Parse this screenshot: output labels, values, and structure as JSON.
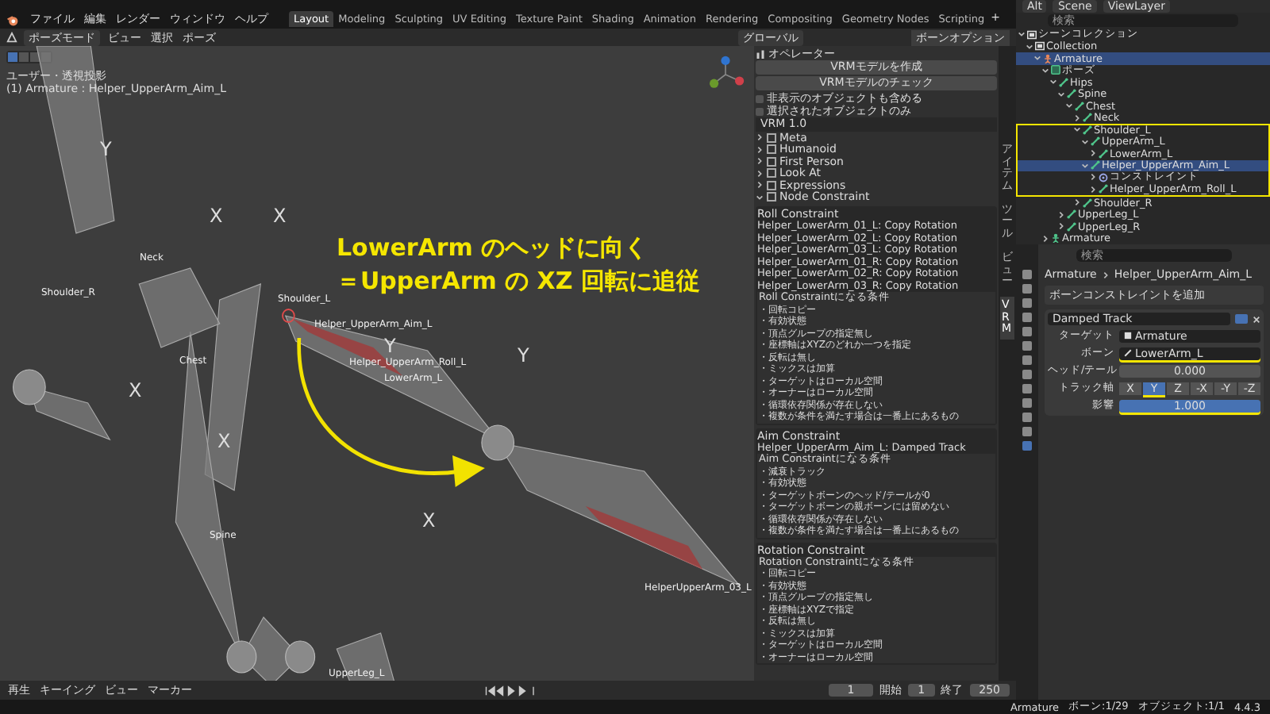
{
  "top_bar": {
    "menus": [
      "ファイル",
      "編集",
      "レンダー",
      "ウィンドウ",
      "ヘルプ"
    ],
    "workspaces": [
      {
        "label": "Layout",
        "selected": true
      },
      {
        "label": "Modeling",
        "selected": false
      },
      {
        "label": "Sculpting",
        "selected": false
      },
      {
        "label": "UV Editing",
        "selected": false
      },
      {
        "label": "Texture Paint",
        "selected": false
      },
      {
        "label": "Shading",
        "selected": false
      },
      {
        "label": "Animation",
        "selected": false
      },
      {
        "label": "Rendering",
        "selected": false
      },
      {
        "label": "Compositing",
        "selected": false
      },
      {
        "label": "Geometry Nodes",
        "selected": false
      },
      {
        "label": "Scripting",
        "selected": false
      }
    ],
    "add_tab": "+"
  },
  "viewport": {
    "mode": "ポーズモード",
    "menus": [
      "ビュー",
      "選択",
      "ポーズ"
    ],
    "orientation": "グローバル",
    "panel_tab": "ボーンオプション",
    "view_label": "ユーザー・透視投影",
    "object_label": "(1) Armature : Helper_UpperArm_Aim_L",
    "bone_labels": [
      "Neck",
      "Shoulder_L",
      "Shoulder_R",
      "Chest",
      "Spine",
      "Helper_UpperArm_Aim_L",
      "Helper_UpperArm_Roll_L",
      "LowerArm_L",
      "HelperUpperArm_03_L",
      "UpperLeg_L"
    ],
    "axis_letters": [
      "Y",
      "X",
      "X",
      "Y",
      "X",
      "Y",
      "X",
      "X"
    ],
    "annotation": [
      "LowerArm のヘッドに向く",
      "＝UpperArm の XZ 回転に追従"
    ]
  },
  "n_panel": {
    "title": "オペレーター",
    "buttons": [
      "VRMモデルを作成",
      "VRMモデルのチェック"
    ],
    "checkboxes": [
      {
        "label": "非表示のオブジェクトも含める",
        "checked": false
      },
      {
        "label": "選択されたオブジェクトのみ",
        "checked": false
      }
    ],
    "version": "VRM 1.0",
    "sections": [
      {
        "label": "Meta",
        "expanded": false
      },
      {
        "label": "Humanoid",
        "expanded": false
      },
      {
        "label": "First Person",
        "expanded": false
      },
      {
        "label": "Look At",
        "expanded": false
      },
      {
        "label": "Expressions",
        "expanded": false
      },
      {
        "label": "Node Constraint",
        "expanded": true
      }
    ],
    "subpanels": [
      {
        "title": "Roll Constraint",
        "rows": [
          "Helper_LowerArm_01_L: Copy Rotation",
          "Helper_LowerArm_02_L: Copy Rotation",
          "Helper_LowerArm_03_L: Copy Rotation",
          "Helper_LowerArm_01_R: Copy Rotation",
          "Helper_LowerArm_02_R: Copy Rotation",
          "Helper_LowerArm_03_R: Copy Rotation"
        ],
        "conditions_title": "Roll Constraintになる条件",
        "conditions": [
          "・回転コピー",
          "・有効状態",
          "・頂点グループの指定無し",
          "・座標軸はXYZのどれか一つを指定",
          "・反転は無し",
          "・ミックスは加算",
          "・ターゲットはローカル空間",
          "・オーナーはローカル空間",
          "・循環依存関係が存在しない",
          "・複数が条件を満たす場合は一番上にあるもの"
        ]
      },
      {
        "title": "Aim Constraint",
        "rows": [
          "Helper_UpperArm_Aim_L: Damped Track"
        ],
        "conditions_title": "Aim Constraintになる条件",
        "conditions": [
          "・減衰トラック",
          "・有効状態",
          "・ターゲットボーンのヘッド/テールが0",
          "・ターゲットボーンの親ボーンには留めない",
          "・循環依存関係が存在しない",
          "・複数が条件を満たす場合は一番上にあるもの"
        ]
      },
      {
        "title": "Rotation Constraint",
        "conditions_title": "Rotation Constraintになる条件",
        "conditions": [
          "・回転コピー",
          "・有効状態",
          "・頂点グループの指定無し",
          "・座標軸はXYZで指定",
          "・反転は無し",
          "・ミックスは加算",
          "・ターゲットはローカル空間",
          "・オーナーはローカル空間"
        ]
      }
    ],
    "tabs": [
      {
        "label": "アイテム",
        "selected": false
      },
      {
        "label": "ツール",
        "selected": false
      },
      {
        "label": "ビュー",
        "selected": false
      },
      {
        "label": "VRM",
        "selected": true
      }
    ]
  },
  "outliner": {
    "display_mode": "Alt",
    "scene": "Scene",
    "view_layer": "ViewLayer",
    "search": {
      "placeholder": "検索"
    },
    "tree": [
      {
        "label": "シーンコレクション",
        "kind": "collection",
        "expanded": true,
        "selected": false,
        "children": [
          {
            "label": "Collection",
            "kind": "collection",
            "expanded": true,
            "selected": false,
            "children": [
              {
                "label": "Armature",
                "kind": "armature",
                "expanded": true,
                "selected": true,
                "children": [
                  {
                    "label": "ポーズ",
                    "kind": "pose",
                    "expanded": true,
                    "selected": false,
                    "children": [
                      {
                        "label": "Hips",
                        "kind": "bone",
                        "expanded": true,
                        "selected": false,
                        "children": [
                          {
                            "label": "Spine",
                            "kind": "bone",
                            "expanded": true,
                            "selected": false,
                            "children": [
                              {
                                "label": "Chest",
                                "kind": "bone",
                                "expanded": true,
                                "selected": false,
                                "children": [
                                  {
                                    "label": "Neck",
                                    "kind": "bone",
                                    "expanded": false,
                                    "selected": false
                                  },
                                  {
                                    "label": "Shoulder_L",
                                    "kind": "bone",
                                    "expanded": true,
                                    "selected": false,
                                    "highlighted": true,
                                    "children": [
                                      {
                                        "label": "UpperArm_L",
                                        "kind": "bone",
                                        "expanded": true,
                                        "selected": false,
                                        "children": [
                                          {
                                            "label": "LowerArm_L",
                                            "kind": "bone",
                                            "expanded": false,
                                            "selected": false
                                          }
                                        ]
                                      },
                                      {
                                        "label": "Helper_UpperArm_Aim_L",
                                        "kind": "bone",
                                        "expanded": true,
                                        "selected": true,
                                        "children": [
                                          {
                                            "label": "コンストレイント",
                                            "kind": "constraint",
                                            "expanded": false,
                                            "selected": false
                                          },
                                          {
                                            "label": "Helper_UpperArm_Roll_L",
                                            "kind": "bone",
                                            "expanded": false,
                                            "selected": false
                                          }
                                        ]
                                      }
                                    ]
                                  },
                                  {
                                    "label": "Shoulder_R",
                                    "kind": "bone",
                                    "expanded": false,
                                    "selected": false
                                  }
                                ]
                              }
                            ]
                          },
                          {
                            "label": "UpperLeg_L",
                            "kind": "bone",
                            "expanded": false,
                            "selected": false
                          },
                          {
                            "label": "UpperLeg_R",
                            "kind": "bone",
                            "expanded": false,
                            "selected": false
                          }
                        ]
                      }
                    ]
                  },
                  {
                    "label": "Armature",
                    "kind": "data",
                    "expanded": false,
                    "selected": false
                  }
                ]
              }
            ]
          }
        ]
      }
    ]
  },
  "properties": {
    "search": {
      "placeholder": "検索"
    },
    "breadcrumb": [
      "Armature",
      "Helper_UpperArm_Aim_L"
    ],
    "add_constraint": "ボーンコンストレイントを追加",
    "constraint_name": "Damped Track",
    "fields": [
      {
        "kind": "field",
        "label": "ターゲット",
        "value": "Armature",
        "underlined": false
      },
      {
        "kind": "field",
        "label": "ボーン",
        "value": "LowerArm_L",
        "underlined": true
      },
      {
        "kind": "number",
        "label": "ヘッド/テール",
        "value": "0.000",
        "underlined": false
      },
      {
        "kind": "axis",
        "label": "トラック軸",
        "options": [
          {
            "label": "X",
            "selected": false
          },
          {
            "label": "Y",
            "selected": true
          },
          {
            "label": "Z",
            "selected": false
          },
          {
            "label": "-X",
            "selected": false
          },
          {
            "label": "-Y",
            "selected": false
          },
          {
            "label": "-Z",
            "selected": false
          }
        ],
        "underlined": true
      },
      {
        "kind": "slider",
        "label": "影響",
        "value": "1.000",
        "level": 1,
        "underlined": true
      }
    ]
  },
  "timeline": {
    "menus": [
      "再生",
      "キーイング",
      "ビュー",
      "マーカー"
    ],
    "current_frame": "1",
    "start_label": "開始",
    "start": "1",
    "end_label": "終了",
    "end": "250"
  },
  "status_bar": [
    "Armature",
    "ボーン:1/29",
    "オブジェクト:1/1",
    "4.4.3"
  ]
}
